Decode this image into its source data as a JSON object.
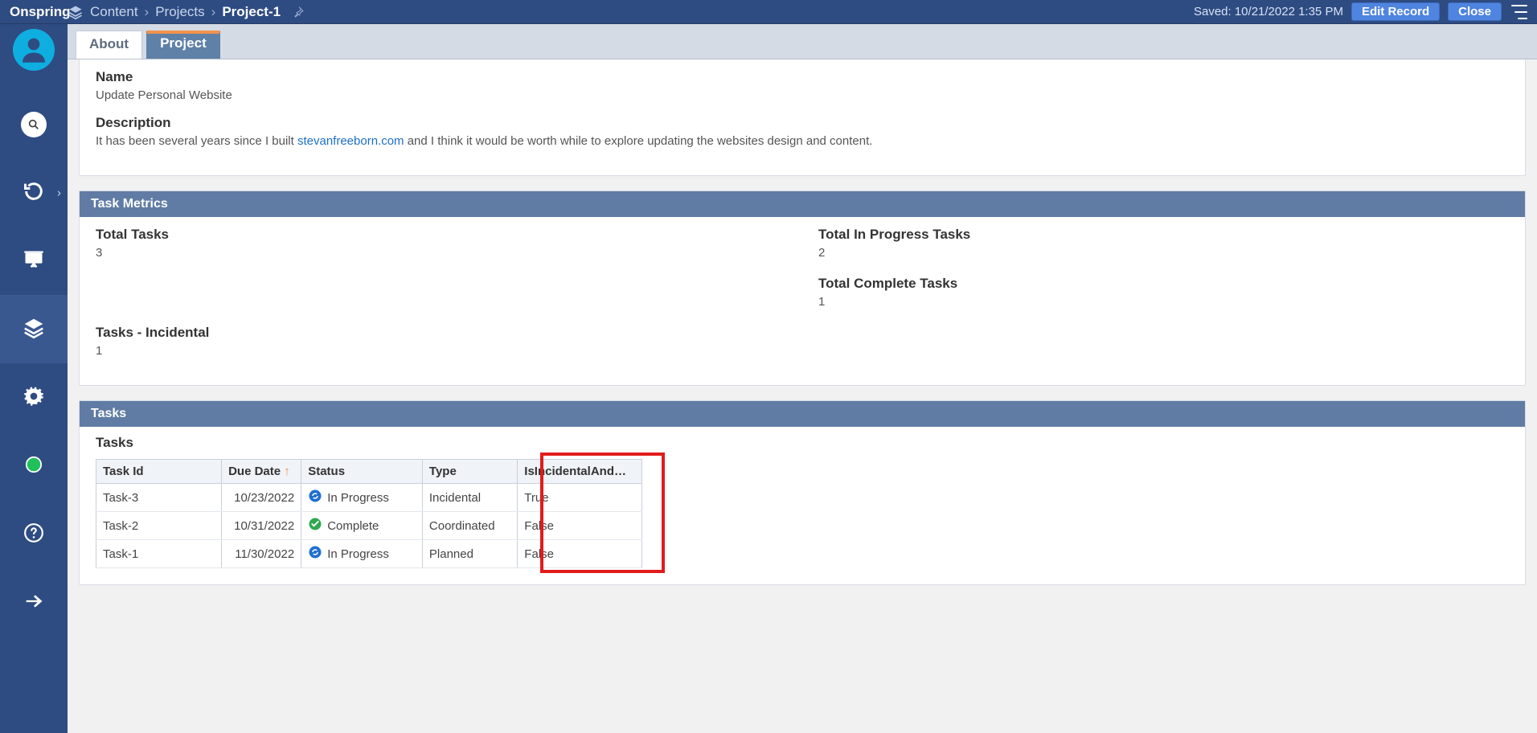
{
  "app_name": "Onspring",
  "breadcrumbs": {
    "root": "Content",
    "mid": "Projects",
    "leaf": "Project-1"
  },
  "saved_text": "Saved: 10/21/2022 1:35 PM",
  "buttons": {
    "edit": "Edit Record",
    "close": "Close"
  },
  "tabs": {
    "about": "About",
    "project": "Project"
  },
  "name": {
    "label": "Name",
    "value": "Update Personal Website"
  },
  "description": {
    "label": "Description",
    "prefix": "It has been several years since I built ",
    "link_text": "stevanfreeborn.com",
    "suffix": " and I think it would be worth while to explore updating the websites design and content."
  },
  "panel_titles": {
    "metrics": "Task Metrics",
    "tasks": "Tasks"
  },
  "metrics": {
    "total_tasks": {
      "label": "Total Tasks",
      "value": "3"
    },
    "in_progress": {
      "label": "Total In Progress Tasks",
      "value": "2"
    },
    "complete": {
      "label": "Total Complete Tasks",
      "value": "1"
    },
    "incidental": {
      "label": "Tasks - Incidental",
      "value": "1"
    }
  },
  "tasks_table": {
    "title": "Tasks",
    "columns": {
      "id": "Task Id",
      "due": "Due Date",
      "status": "Status",
      "type": "Type",
      "isinc": "IsIncidentalAnd…"
    },
    "rows": [
      {
        "id": "Task-3",
        "due": "10/23/2022",
        "status": "In Progress",
        "status_icon": "refresh",
        "type": "Incidental",
        "isinc": "True"
      },
      {
        "id": "Task-2",
        "due": "10/31/2022",
        "status": "Complete",
        "status_icon": "check",
        "type": "Coordinated",
        "isinc": "False"
      },
      {
        "id": "Task-1",
        "due": "11/30/2022",
        "status": "In Progress",
        "status_icon": "refresh",
        "type": "Planned",
        "isinc": "False"
      }
    ]
  }
}
